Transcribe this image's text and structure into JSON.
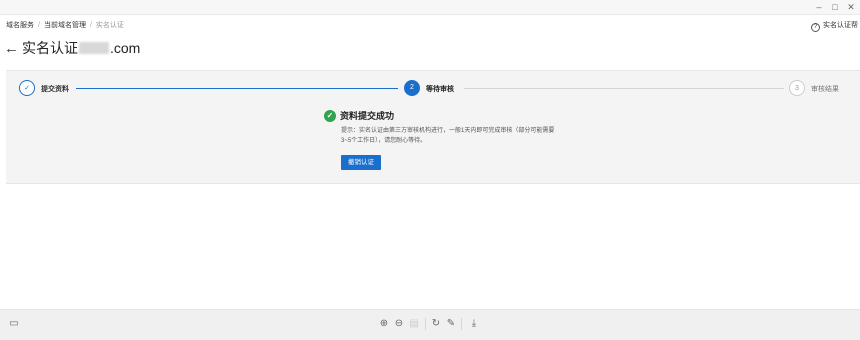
{
  "window": {
    "minimize_icon": "minimize-icon",
    "maximize_icon": "maximize-icon",
    "close_icon": "close-icon",
    "minimize_glyph": "–",
    "maximize_glyph": "□",
    "close_glyph": "✕"
  },
  "breadcrumb": {
    "items": [
      "域名服务",
      "当前域名管理",
      "实名认证"
    ],
    "separator": "/"
  },
  "help": {
    "label": "实名认证帮",
    "icon_glyph": "?"
  },
  "header": {
    "back_glyph": "←",
    "title_prefix": "实名认证",
    "title_suffix": ".com"
  },
  "steps": [
    {
      "number": "✓",
      "label": "提交资料",
      "state": "done"
    },
    {
      "number": "2",
      "label": "等待审核",
      "state": "active"
    },
    {
      "number": "3",
      "label": "审核结果",
      "state": "pending"
    }
  ],
  "result": {
    "check_glyph": "✓",
    "title": "资料提交成功",
    "hint": "提示：实名认证由第三方审核机构进行，一般1天内即可完成审核（部分可能需要3~5个工作日），请您耐心等待。",
    "revoke_button": "撤销认证"
  },
  "colors": {
    "accent": "#1a6ecc",
    "success": "#2ea44f"
  },
  "toolbar": {
    "left_icon": "panel-icon",
    "left_glyph": "▭",
    "zoom_in_glyph": "⊕",
    "zoom_out_glyph": "⊖",
    "fit_glyph": "▤",
    "rotate_glyph": "↻",
    "edit_glyph": "✎",
    "download_glyph": "⤓"
  }
}
